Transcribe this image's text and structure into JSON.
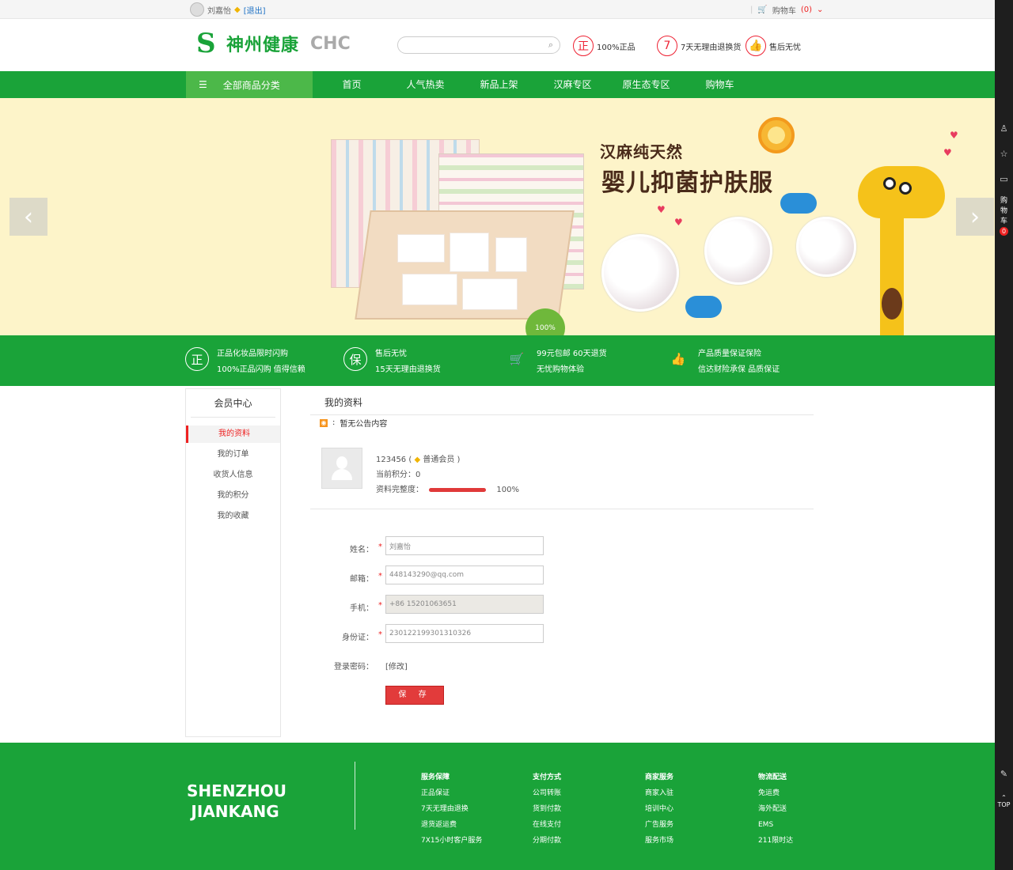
{
  "topbar": {
    "username": "刘嘉怡",
    "logout": "[退出]",
    "cart_label": "购物车",
    "cart_count": "(0)"
  },
  "header": {
    "logo_cn": "神州健康",
    "logo_en": "CHC",
    "search_placeholder": "",
    "promises": [
      {
        "badge": "正",
        "text": "100%正品"
      },
      {
        "badge": "7",
        "text": "7天无理由退换货"
      },
      {
        "badge": "👍",
        "text": "售后无忧"
      }
    ]
  },
  "nav": {
    "all_categories": "全部商品分类",
    "items": [
      "首页",
      "人气热卖",
      "新品上架",
      "汉麻专区",
      "原生态专区",
      "购物车"
    ]
  },
  "banner": {
    "title1": "汉麻纯天然",
    "title2": "婴儿抑菌护肤服",
    "prev": "‹",
    "next": "›"
  },
  "services": [
    {
      "icon": "正",
      "line1": "正品化妆品限时闪购",
      "line2": "100%正品闪购 值得信赖"
    },
    {
      "icon": "保",
      "line1": "售后无忧",
      "line2": "15天无理由退换货"
    },
    {
      "icon": "🛒",
      "line1": "99元包邮 60天退货",
      "line2": "无忧购物体验"
    },
    {
      "icon": "👍",
      "line1": "产品质量保证保险",
      "line2": "信达财险承保 品质保证"
    }
  ],
  "sidebar": {
    "title": "会员中心",
    "items": [
      "我的资料",
      "我的订单",
      "收货人信息",
      "我的积分",
      "我的收藏"
    ]
  },
  "content": {
    "heading": "我的资料",
    "notice": "暂无公告内容",
    "profile": {
      "user_id": "123456",
      "level": "普通会员",
      "points_label": "当前积分：",
      "points": "0",
      "completeness_label": "资料完整度：",
      "completeness": "100%",
      "completeness_value": 1.0
    },
    "form": {
      "name_label": "姓名：",
      "name_value": "刘嘉怡",
      "email_label": "邮箱：",
      "email_value": "448143290@qq.com",
      "phone_label": "手机：",
      "phone_value": "+86 15201063651",
      "id_label": "身份证：",
      "id_value": "230122199301310326",
      "password_label": "登录密码：",
      "password_action": "[修改]",
      "save_label": "保 存"
    }
  },
  "footer": {
    "brand_line1": "SHENZHOU",
    "brand_line2": "JIANKANG",
    "columns": [
      {
        "title": "服务保障",
        "items": [
          "正品保证",
          "7天无理由退换",
          "退货返运费",
          "7X15小时客户服务"
        ]
      },
      {
        "title": "支付方式",
        "items": [
          "公司转账",
          "货到付款",
          "在线支付",
          "分期付款"
        ]
      },
      {
        "title": "商家服务",
        "items": [
          "商家入驻",
          "培训中心",
          "广告服务",
          "服务市场"
        ]
      },
      {
        "title": "物流配送",
        "items": [
          "免运费",
          "海外配送",
          "EMS",
          "211限时达"
        ]
      }
    ]
  },
  "rightbar": {
    "cart_label": "购物车",
    "cart_count": "0",
    "top_label": "TOP"
  },
  "colors": {
    "brand_green": "#1aa339",
    "accent_red": "#e23b3b"
  }
}
